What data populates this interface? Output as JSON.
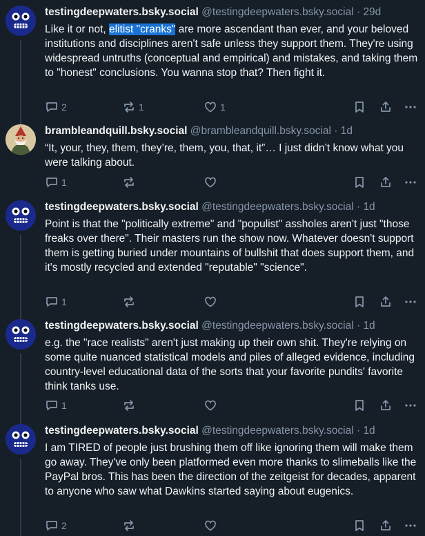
{
  "theme": {
    "background": "#161e27",
    "text": "#f1f3f5",
    "muted": "#8596a9",
    "highlight": "#1972d4",
    "thread_line": "#2e3c4c"
  },
  "posts": [
    {
      "author": "testingdeepwaters.bsky.social",
      "handle": "@testingdeepwaters.bsky.social",
      "dot": "·",
      "time": "29d",
      "avatar_icon": "blue-robot-face-icon",
      "text_before": "Like it or not, ",
      "text_highlight": "elitist \"cranks\"",
      "text_after": " are more ascendant than ever, and your beloved institutions and disciplines aren't safe unless they support them. They're using widespread untruths (conceptual and empirical) and mistakes, and taking them to \"honest\" conclusions. You wanna stop that? Then fight it.",
      "replies": "2",
      "reposts": "1",
      "likes": "1"
    },
    {
      "author": "brambleandquill.bsky.social",
      "handle": "@brambleandquill.bsky.social",
      "dot": "·",
      "time": "1d",
      "avatar_icon": "gnome-illustration-icon",
      "text": "“It, your, they, them, they’re, them, you, that, it”… I just didn’t know what you were talking about.",
      "replies": "1",
      "reposts": "",
      "likes": ""
    },
    {
      "author": "testingdeepwaters.bsky.social",
      "handle": "@testingdeepwaters.bsky.social",
      "dot": "·",
      "time": "1d",
      "avatar_icon": "blue-robot-face-icon",
      "text": "Point is that the \"politically extreme\" and \"populist\" assholes aren't just \"those freaks over there\". Their masters run the show now. Whatever doesn't support them is getting buried under mountains of bullshit that does support them, and it's mostly recycled and extended \"reputable\" \"science\".",
      "replies": "1",
      "reposts": "",
      "likes": ""
    },
    {
      "author": "testingdeepwaters.bsky.social",
      "handle": "@testingdeepwaters.bsky.social",
      "dot": "·",
      "time": "1d",
      "avatar_icon": "blue-robot-face-icon",
      "text": "e.g. the \"race realists\" aren't just making up their own shit. They're relying on some quite nuanced statistical models and piles of alleged evidence, including country-level educational data of the sorts that your favorite pundits' favorite think tanks use.",
      "replies": "1",
      "reposts": "",
      "likes": ""
    },
    {
      "author": "testingdeepwaters.bsky.social",
      "handle": "@testingdeepwaters.bsky.social",
      "dot": "·",
      "time": "1d",
      "avatar_icon": "blue-robot-face-icon",
      "text": "I am TIRED of people just brushing them off like ignoring them will make them go away. They've only been platformed even more thanks to slimeballs like the PayPal bros. This has been the direction of the zeitgeist for decades, apparent to anyone who saw what Dawkins started saying about eugenics.",
      "replies": "2",
      "reposts": "",
      "likes": ""
    }
  ]
}
